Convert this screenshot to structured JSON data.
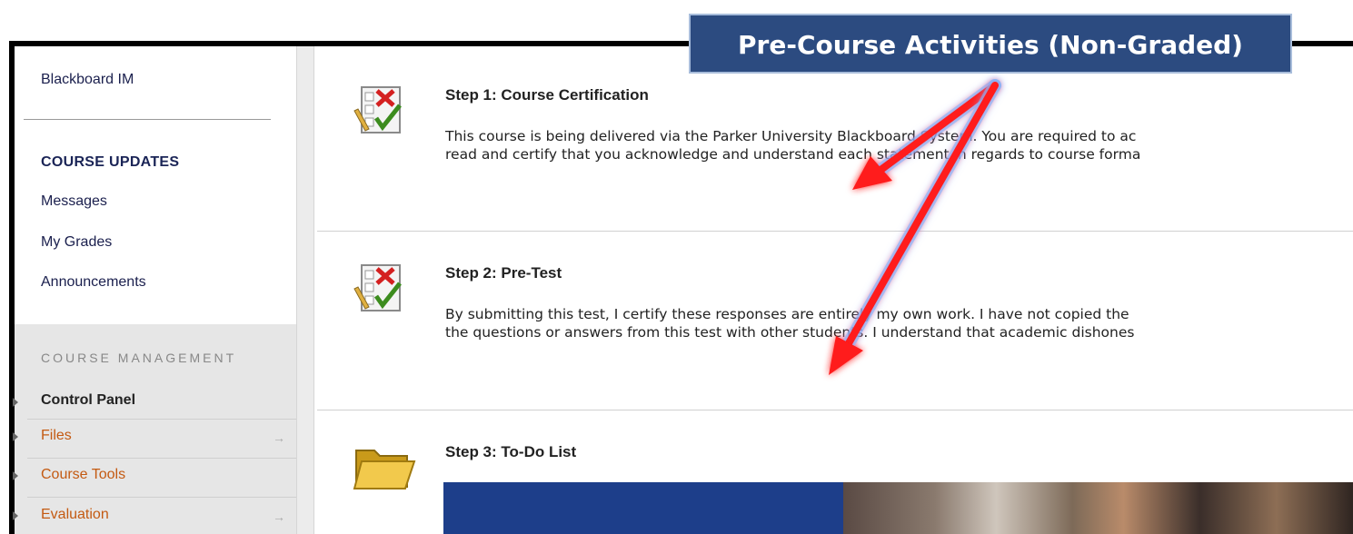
{
  "banner": {
    "title": "Pre-Course Activities (Non-Graded)"
  },
  "sidebar": {
    "top_link": "Blackboard IM",
    "course_updates_heading": "COURSE UPDATES",
    "updates_items": [
      "Messages",
      "My Grades",
      "Announcements"
    ],
    "course_management_heading": "COURSE MANAGEMENT",
    "control_panel_label": "Control Panel",
    "cp_items": [
      {
        "label": "Files",
        "arrow": "→"
      },
      {
        "label": "Course Tools",
        "arrow": ""
      },
      {
        "label": "Evaluation",
        "arrow": "→"
      }
    ]
  },
  "content": {
    "steps": [
      {
        "title": "Step 1: Course Certification",
        "desc_line1": "This course is being delivered via the Parker University Blackboard System. You are required to ac",
        "desc_line2": "read and certify that you acknowledge and understand each statement in regards to course forma",
        "icon": "test-icon"
      },
      {
        "title": "Step 2: Pre-Test",
        "desc_line1": "By submitting this test, I certify these responses are entirely my own work. I have not copied the",
        "desc_line2": "the questions or answers from this test with other students. I understand that academic dishones",
        "icon": "test-icon"
      },
      {
        "title": "Step 3: To-Do List",
        "icon": "folder-icon"
      }
    ]
  },
  "colors": {
    "banner_bg": "#2c4b80",
    "annotation_arrow": "#ff1a1a",
    "sidebar_link": "#c45a12",
    "sidebar_text": "#1a1f4d"
  }
}
